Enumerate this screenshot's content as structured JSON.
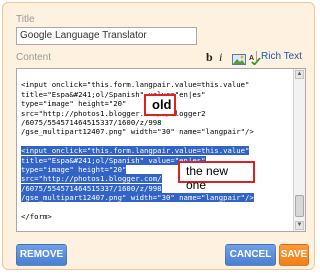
{
  "form": {
    "title_label": "Title",
    "title_value": "Google Language Translator",
    "content_label": "Content"
  },
  "toolbar": {
    "bold": "b",
    "italic": "i",
    "image_icon": "image-icon",
    "spellcheck_icon": "spellcheck-icon",
    "separator": "|",
    "rich_text_link": "Rich Text"
  },
  "editor": {
    "lines_before": [
      "",
      "<input onclick=\"this.form.langpair.value=this.value\"",
      "title=\"Espa&#241;ol/Spanish\" value=\"en|es\"",
      "type=\"image\" height=\"20\"",
      "src=\"http://photos1.blogger.com/x/blogger2",
      "/6075/554571464515337/1600/z/998",
      "/gse_multipart12407.png\" width=\"30\" name=\"langpair\"/>",
      ""
    ],
    "selected_lines": [
      "<input onclick=\"this.form.langpair.value=this.value\"",
      "title=\"Espa&#241;ol/Spanish\" value=\"en|es\"",
      "type=\"image\" height=\"20\"",
      "src=\"http://photos1.blogger.com/",
      "/6075/554571464515337/1600/z/998",
      "/gse_multipart12407.png\" width=\"30\" name=\"langpair\"/>"
    ],
    "lines_after": [
      "",
      "</form>"
    ]
  },
  "annotations": {
    "old": "old",
    "new": "the new one",
    "accent_color": "#dd2222"
  },
  "buttons": {
    "remove": "REMOVE",
    "cancel": "CANCEL",
    "save": "SAVE"
  },
  "colors": {
    "panel_background": "#fff1e0",
    "panel_border": "#f0c696",
    "selection": "#3164c6",
    "blue_button": "#4a7fd0",
    "orange_button": "#f07f17"
  }
}
